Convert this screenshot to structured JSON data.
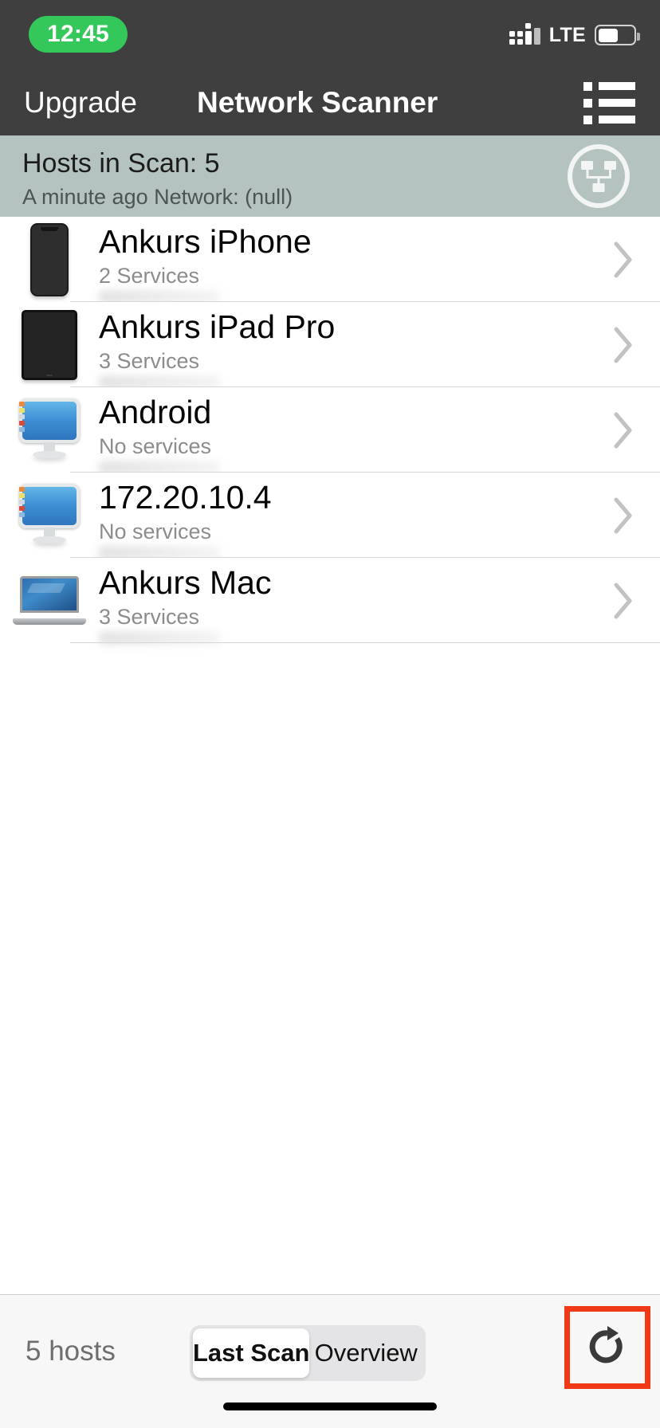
{
  "status_bar": {
    "time": "12:45",
    "time_pill_color": "#34c759",
    "carrier_network": "LTE",
    "battery_level_pct": 58,
    "signal_icon": "cellular-signal-dots-icon",
    "battery_icon": "battery-icon"
  },
  "nav_bar": {
    "background": "#3f3f3f",
    "left_button": "Upgrade",
    "title": "Network Scanner",
    "menu_icon": "list-menu-icon"
  },
  "info_band": {
    "background": "#b5c3c0",
    "title": "Hosts in Scan: 5",
    "subtitle": "A minute ago  Network: (null)",
    "badge_icon": "network-topology-icon"
  },
  "hosts": [
    {
      "name": "Ankurs iPhone",
      "services": "2 Services",
      "icon": "iphone-device-icon",
      "ip_redacted": true
    },
    {
      "name": "Ankurs iPad Pro",
      "services": "3 Services",
      "icon": "ipad-device-icon",
      "ip_redacted": true
    },
    {
      "name": "Android",
      "services": "No services",
      "icon": "desktop-computer-icon",
      "ip_redacted": true
    },
    {
      "name": "172.20.10.4",
      "services": "No services",
      "icon": "desktop-computer-icon",
      "ip_redacted": true
    },
    {
      "name": "Ankurs Mac",
      "services": "3 Services",
      "icon": "macbook-laptop-icon",
      "ip_redacted": true
    }
  ],
  "toolbar": {
    "hosts_count_label": "5 hosts",
    "segments": [
      {
        "label": "Last Scan",
        "selected": true
      },
      {
        "label": "Overview",
        "selected": false
      }
    ],
    "refresh_icon": "refresh-icon",
    "refresh_highlight_color": "#f03a17"
  }
}
